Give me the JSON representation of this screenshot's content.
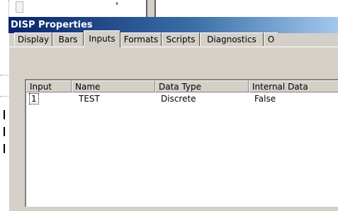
{
  "dialog": {
    "title": "DISP Properties"
  },
  "tabs": [
    {
      "label": "Display"
    },
    {
      "label": "Bars"
    },
    {
      "label": "Inputs"
    },
    {
      "label": "Formats"
    },
    {
      "label": "Scripts"
    },
    {
      "label": "Diagnostics"
    },
    {
      "label": "O"
    }
  ],
  "active_tab": "Inputs",
  "table": {
    "columns": [
      "Input",
      "Name",
      "Data Type",
      "Internal Data"
    ],
    "rows": [
      {
        "input": "1",
        "name": "TEST",
        "data_type": "Discrete",
        "internal_data": "False"
      }
    ]
  }
}
